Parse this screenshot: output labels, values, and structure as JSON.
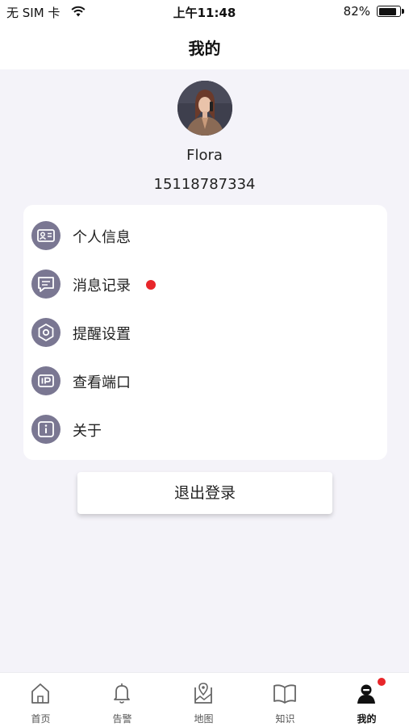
{
  "status_bar": {
    "carrier": "无 SIM 卡",
    "time": "上午11:48",
    "battery": "82%"
  },
  "header": {
    "title": "我的"
  },
  "profile": {
    "name": "Flora",
    "phone": "15118787334"
  },
  "menu": {
    "items": [
      {
        "label": "个人信息",
        "icon": "id-card-icon"
      },
      {
        "label": "消息记录",
        "icon": "message-icon",
        "unread": true
      },
      {
        "label": "提醒设置",
        "icon": "settings-hexagon-icon"
      },
      {
        "label": "查看端口",
        "icon": "ip-icon"
      },
      {
        "label": "关于",
        "icon": "info-icon"
      }
    ]
  },
  "logout": {
    "label": "退出登录"
  },
  "tabbar": {
    "tabs": [
      {
        "label": "首页",
        "icon": "home-icon"
      },
      {
        "label": "告警",
        "icon": "bell-icon"
      },
      {
        "label": "地图",
        "icon": "map-icon"
      },
      {
        "label": "知识",
        "icon": "book-icon"
      },
      {
        "label": "我的",
        "icon": "user-icon",
        "active": true
      }
    ]
  },
  "colors": {
    "accent_icon": "#7a7792",
    "badge": "#e8262a",
    "background": "#f4f3f9"
  }
}
